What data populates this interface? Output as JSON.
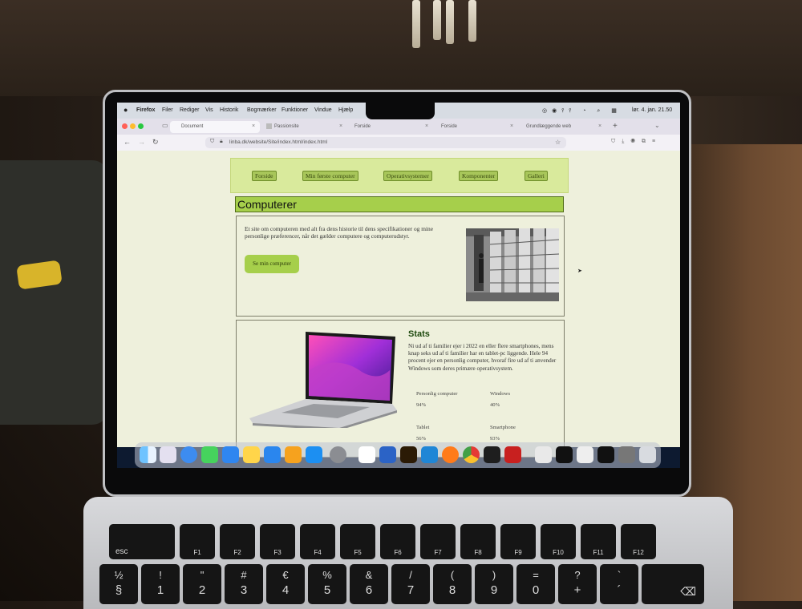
{
  "menubar": {
    "app": "Firefox",
    "items": [
      "Filer",
      "Rediger",
      "Vis",
      "Historik",
      "Bogmærker",
      "Funktioner",
      "Vindue",
      "Hjælp"
    ],
    "clock": "lør. 4. jan. 21.50"
  },
  "tabs": [
    {
      "label": "Document"
    },
    {
      "label": "Passionsite"
    },
    {
      "label": "Forside"
    },
    {
      "label": "Forside"
    },
    {
      "label": "Grundlæggende web"
    }
  ],
  "url": "linba.dk/website/Site/index.html/index.html",
  "nav": [
    "Forside",
    "Min første computer",
    "Operativsystemer",
    "Komponenter",
    "Galleri"
  ],
  "page_title": "Computerer",
  "intro_text": "Et site om computeren med alt fra dens historie til dens specifikationer og mine personlige præferencer, når det gælder computere og computerudstyr.",
  "cta_label": "Se min computer",
  "stats": {
    "heading": "Stats",
    "text": "Ni ud af ti familier ejer i 2022 en eller flere smartphones, mens knap seks ud af ti familier har en tablet-pc liggende. Hele 94 procent ejer en personlig computer, hvoraf fire ud af ti anvender Windows som deres primære operativsystem.",
    "items": [
      {
        "label": "Personlig computer",
        "value": "94%"
      },
      {
        "label": "Windows",
        "value": "40%"
      },
      {
        "label": "Tablet",
        "value": "56%"
      },
      {
        "label": "Smartphone",
        "value": "93%"
      }
    ]
  },
  "keyboard": {
    "row1": [
      "esc",
      "F1",
      "F2",
      "F3",
      "F4",
      "F5",
      "F6",
      "F7",
      "F8",
      "F9",
      "F10",
      "F11",
      "F12"
    ],
    "row2": [
      {
        "top": "½",
        "bottom": "§"
      },
      {
        "top": "!",
        "bottom": "1"
      },
      {
        "top": "\"",
        "bottom": "2"
      },
      {
        "top": "#",
        "bottom": "3"
      },
      {
        "top": "€",
        "bottom": "4"
      },
      {
        "top": "%",
        "bottom": "5"
      },
      {
        "top": "&",
        "bottom": "6"
      },
      {
        "top": "/",
        "bottom": "7"
      },
      {
        "top": "(",
        "bottom": "8"
      },
      {
        "top": ")",
        "bottom": "9"
      },
      {
        "top": "=",
        "bottom": "0"
      },
      {
        "top": "?",
        "bottom": "+"
      },
      {
        "top": "`",
        "bottom": "´"
      }
    ]
  }
}
